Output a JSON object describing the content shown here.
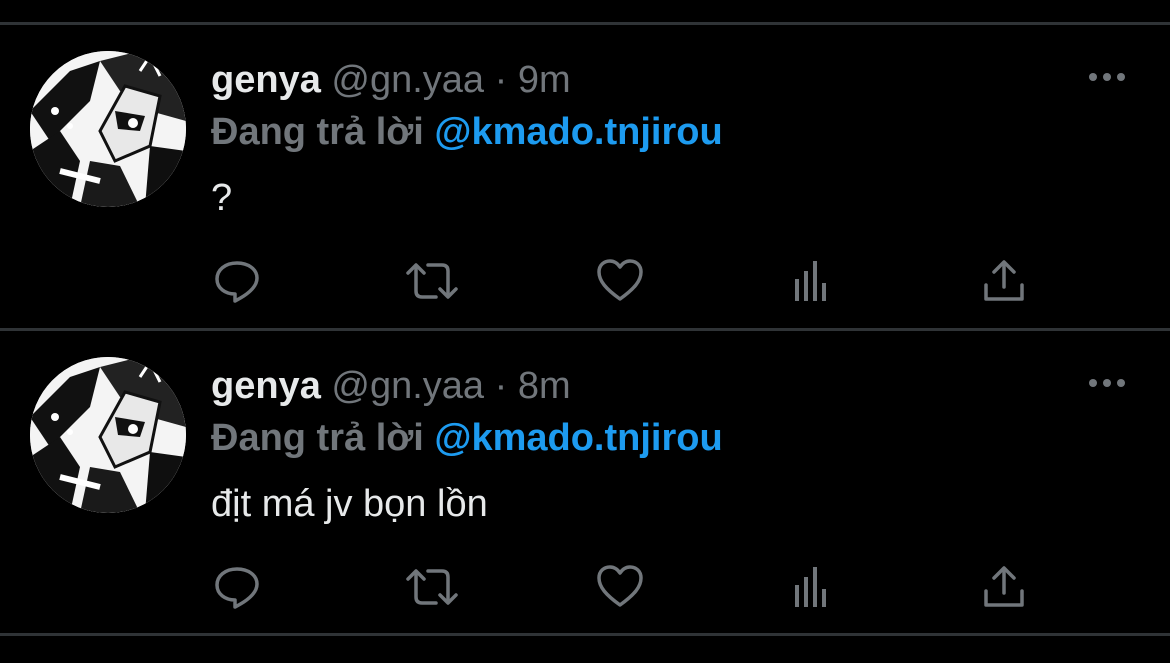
{
  "colors": {
    "background": "#000000",
    "divider": "#2f3336",
    "primary_text": "#e7e9ea",
    "secondary_text": "#71767b",
    "accent": "#1d9bf0"
  },
  "tweets": [
    {
      "author_name": "genya",
      "author_handle": "@gn.yaa",
      "separator": "·",
      "time": "9m",
      "reply_prefix": "Đang trả lời",
      "reply_to": "@kmado.tnjirou",
      "text": "?",
      "icons": [
        "reply-icon",
        "retweet-icon",
        "like-icon",
        "stats-icon",
        "share-icon",
        "more-icon"
      ]
    },
    {
      "author_name": "genya",
      "author_handle": "@gn.yaa",
      "separator": "·",
      "time": "8m",
      "reply_prefix": "Đang trả lời",
      "reply_to": "@kmado.tnjirou",
      "text": "địt má jv bọn lồn",
      "icons": [
        "reply-icon",
        "retweet-icon",
        "like-icon",
        "stats-icon",
        "share-icon",
        "more-icon"
      ]
    }
  ]
}
